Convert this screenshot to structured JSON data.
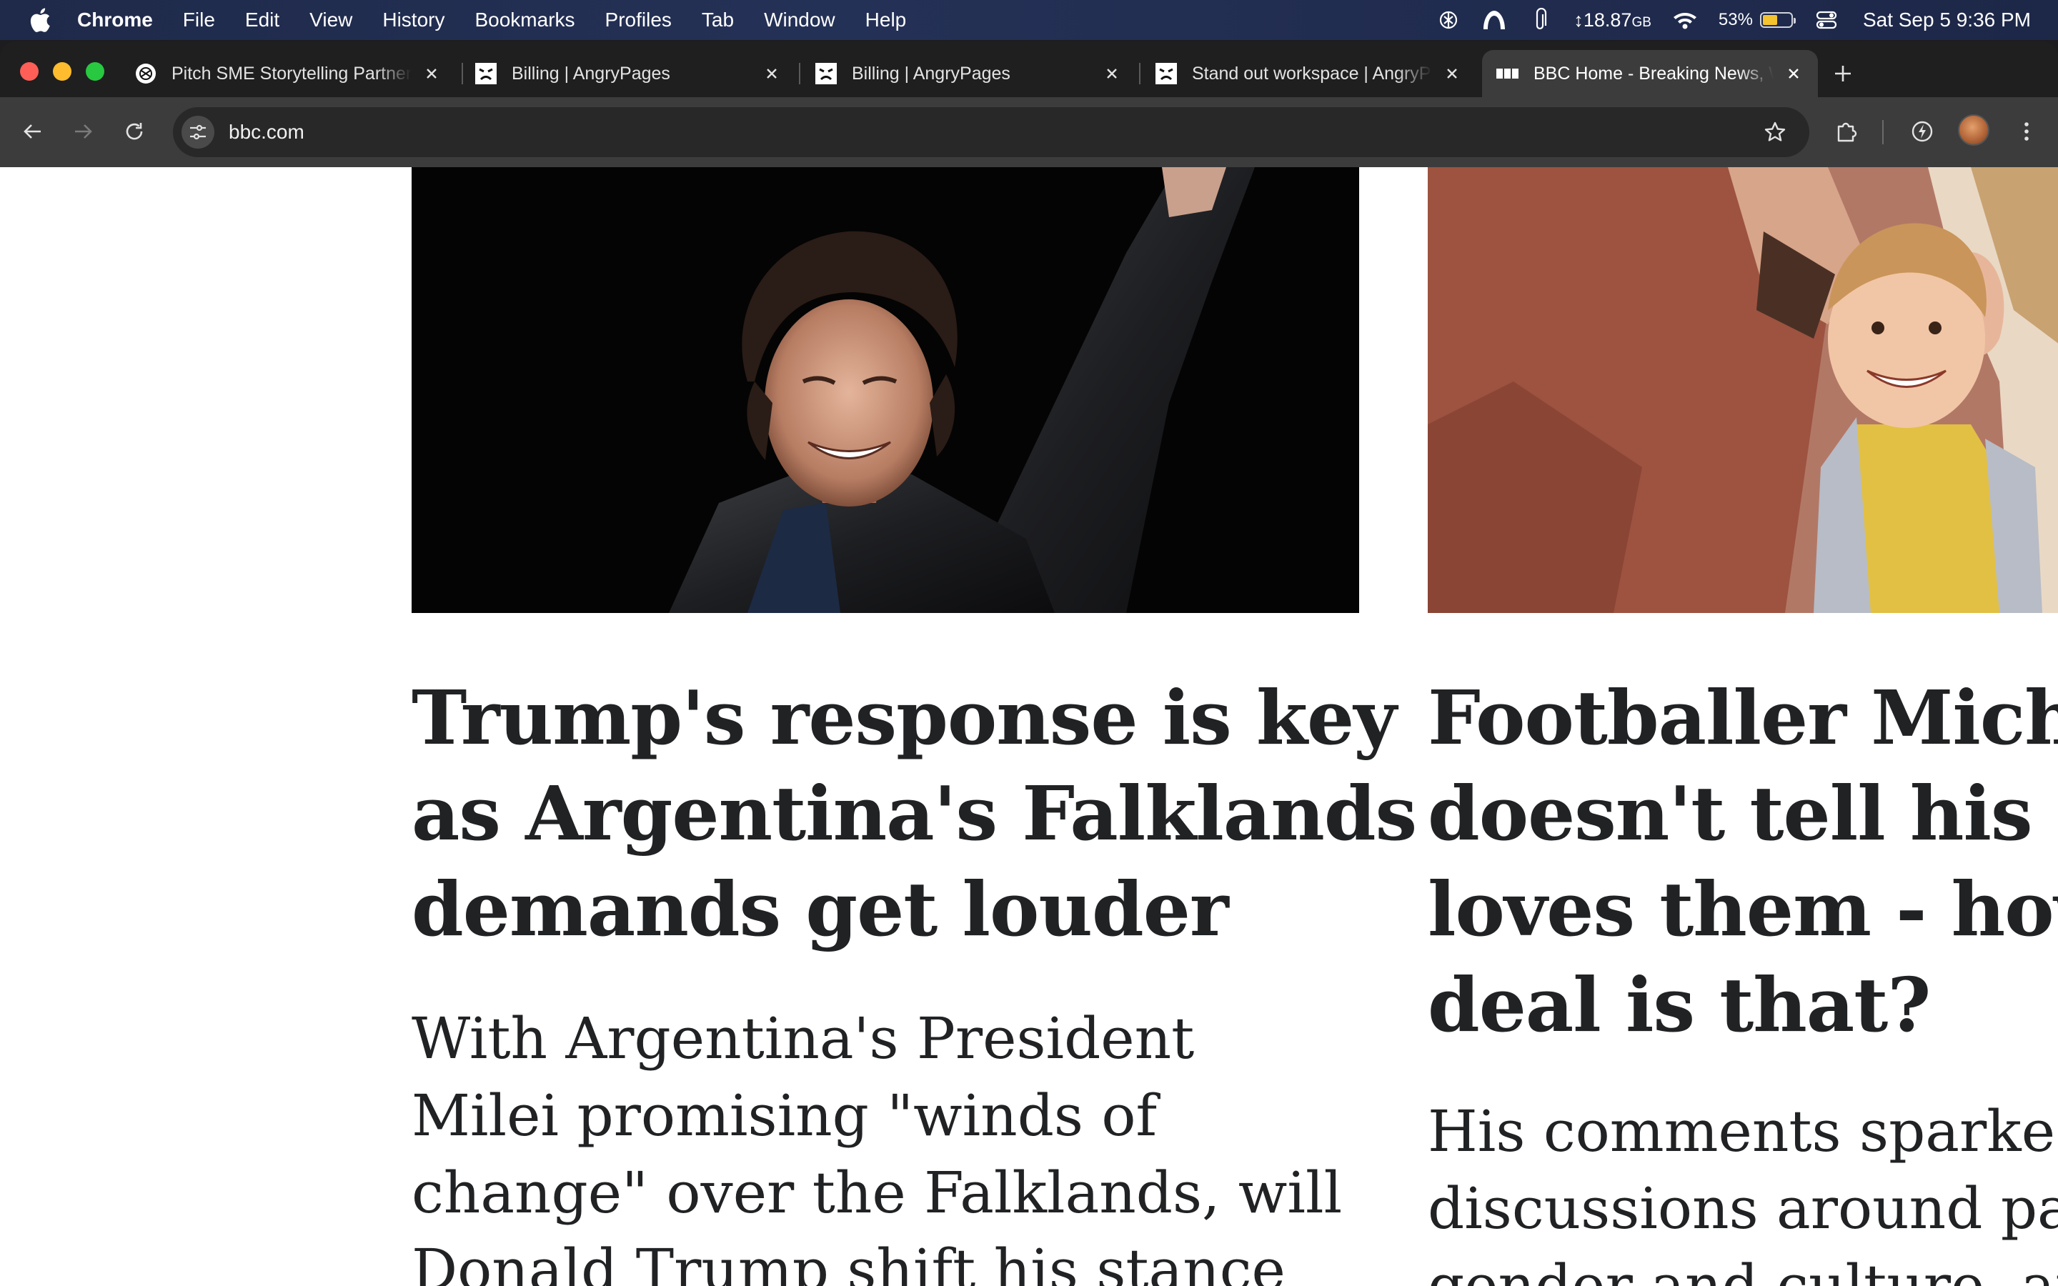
{
  "menubar": {
    "app_name": "Chrome",
    "items": [
      "File",
      "Edit",
      "View",
      "History",
      "Bookmarks",
      "Profiles",
      "Tab",
      "Window",
      "Help"
    ],
    "memory": "↕18.87",
    "memory_unit": "GB",
    "battery_percent": "53%",
    "battery_level": 0.53,
    "clock": "Sat Sep 5  9:36 PM"
  },
  "tabs": [
    {
      "title": "Pitch SME Storytelling Partner",
      "favicon": "openai-icon",
      "active": false
    },
    {
      "title": "Billing | AngryPages",
      "favicon": "angrypages-icon",
      "active": false
    },
    {
      "title": "Billing | AngryPages",
      "favicon": "angrypages-icon",
      "active": false
    },
    {
      "title": "Stand out workspace | AngryPages",
      "favicon": "angrypages-icon",
      "active": false
    },
    {
      "title": "BBC Home - Breaking News, World News",
      "favicon": "bbc-icon",
      "active": true
    }
  ],
  "address_bar": {
    "url": "bbc.com"
  },
  "stories": [
    {
      "headline_lines": [
        "Trump's response is key",
        "as Argentina's Falklands",
        "demands get louder"
      ],
      "summary_lines": [
        "With Argentina's President",
        "Milei promising \"winds of",
        "change\" over the Falklands, will",
        "Donald Trump shift his stance"
      ]
    },
    {
      "headline_lines": [
        "Footballer Michael",
        "doesn't tell his children",
        "loves them - how big a",
        "deal is that?"
      ],
      "summary_lines": [
        "His comments sparked",
        "discussions around parenting,",
        "gender and culture, and"
      ]
    }
  ]
}
